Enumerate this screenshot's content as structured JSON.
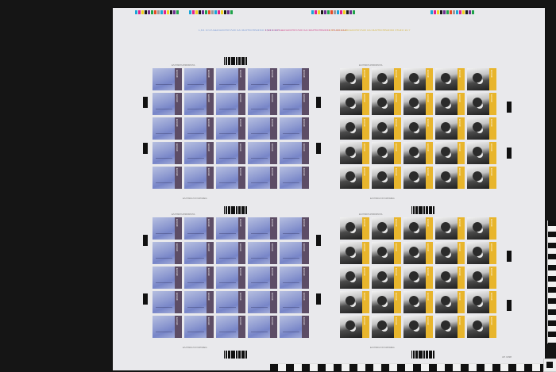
{
  "color_reference_text": [
    {
      "text": "1,6/1 F.N.P.ΑΘΑΝΑΣΟΠΟΥΛΟΣ ΚΑΙ ΜΑΡΠΙΟΠΡΑΦΙΚΟ ΣΤΗΣΟ 16-7",
      "color": "#7b9bd6"
    },
    {
      "text": "1,6/1 F.N.P.ΑΘΑΝΑΣΟΠΟΥΛΟΣ ΚΑΙ ΜΑΡΠΙΟΠΡΑΦΙΚΟ ΣΤΗΣΟ 22-P",
      "color": "#d34a8a"
    },
    {
      "text": "1,6/1 F.N.P.ΑΘΑΝΑΣΟΠΟΥΛΟΣ ΚΑΙ ΜΑΡΠΙΟΠΡΑΦΙΚΟ ΣΤΗΣΟ 16-Y",
      "color": "#d7b84a"
    }
  ],
  "pane_header": "ΕΛΛΗΝΙΚΗ ΔΗΜΟΚΡΑΤΙΑ",
  "pane_footer": "ΕΛΛΗΝΙΚΑ ΤΑΧΥΔΡΟΜΕΙΑ",
  "stamp_side_text": "ΕΛΛΑΣ",
  "sheet_number": "ΑΡ. 0298",
  "colors": {
    "sheet": "#e9e9ec",
    "background": "#151515",
    "blue_stamp_panel": "#5d4d66",
    "mono_stamp_panel": "#e8b52c",
    "colorbar": [
      "#1aa6d8",
      "#e3218b",
      "#f2d21f",
      "#1a1a1a",
      "#6f2f8f",
      "#1fa34a",
      "#e84b25",
      "#999999"
    ]
  },
  "layout_hint": {
    "panes": [
      "blue",
      "mono",
      "blue",
      "mono"
    ],
    "rows": 5,
    "cols": 5
  }
}
